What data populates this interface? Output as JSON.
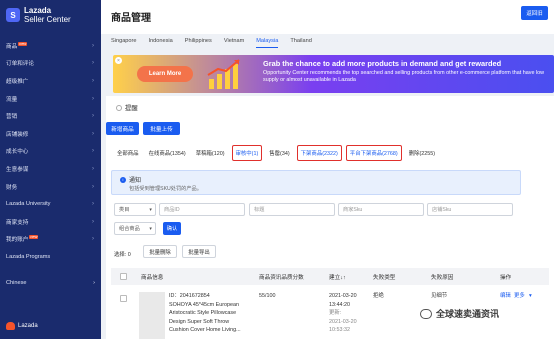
{
  "brand": {
    "name": "Lazada",
    "sub": "Seller Center",
    "logo_letter": "S"
  },
  "sidebar": {
    "items": [
      {
        "label": "商品",
        "badge": "new"
      },
      {
        "label": "订单和评论",
        "badge": ""
      },
      {
        "label": "超级推广",
        "badge": ""
      },
      {
        "label": "流量",
        "badge": ""
      },
      {
        "label": "营销",
        "badge": ""
      },
      {
        "label": "店铺装修",
        "badge": ""
      },
      {
        "label": "成长中心",
        "badge": ""
      },
      {
        "label": "生意参谋",
        "badge": ""
      },
      {
        "label": "财务",
        "badge": ""
      },
      {
        "label": "Lazada University",
        "badge": ""
      },
      {
        "label": "商家支持",
        "badge": ""
      },
      {
        "label": "我的账户",
        "badge": "new"
      },
      {
        "label": "Lazada Programs",
        "badge": ""
      }
    ],
    "language": "Chinese",
    "footer_logo": "Lazada"
  },
  "header": {
    "title": "商品管理",
    "return_label": "返回旧"
  },
  "country_tabs": [
    "Singapore",
    "Indonesia",
    "Philippines",
    "Vietnam",
    "Malaysia",
    "Thailand"
  ],
  "active_country": "Malaysia",
  "banner": {
    "button": "Learn More",
    "title": "Grab the chance to add more products in demand and get rewarded",
    "desc": "Opportunity Center recommends the top searched and selling products from other e-commerce platform that have low supply or almost unavailable in Lazada"
  },
  "section": {
    "title": "提醒",
    "add_product": "新增商品",
    "bulk_upload": "批量上传"
  },
  "status_tabs": [
    {
      "label": "全部商品",
      "highlight": false
    },
    {
      "label": "在线商品(1354)",
      "highlight": false
    },
    {
      "label": "草稿箱(120)",
      "highlight": false
    },
    {
      "label": "审核中(1)",
      "highlight": true
    },
    {
      "label": "售罄(34)",
      "highlight": false
    },
    {
      "label": "下架商品(2322)",
      "highlight": true
    },
    {
      "label": "平台下架商品(2768)",
      "highlight": true
    },
    {
      "label": "删除(2255)",
      "highlight": false
    }
  ],
  "notice": {
    "title": "通知",
    "body": "包括受到管理SKU处罚的产品。"
  },
  "filters": {
    "category": "类目",
    "product_id": "商品ID",
    "title": "标题",
    "seller_sku": "商家Sku",
    "shop_sku": "店铺Sku",
    "combo": "组合商品",
    "product_name": "商品名称",
    "confirm": "确认"
  },
  "bulk": {
    "selected": "选择: 0",
    "delete": "批量删除",
    "export": "批量导出"
  },
  "table": {
    "headers": [
      "商品信息",
      "商品资讯品质分数",
      "建立↓↑",
      "失败类型",
      "失败原因",
      "操作"
    ],
    "row": {
      "id": "ID：2041672854",
      "name_lines": [
        "SOHOYA 45*45cm European",
        "Aristocratic Style Pillowcase",
        "Design Super Soft Throw",
        "Cushion Cover Home Living..."
      ],
      "score": "55/100",
      "created": "2021-03-20",
      "created_time": "13:44:20",
      "updated_label": "更新:",
      "updated": "2021-03-20",
      "updated_time": "10:53:32",
      "fail_type": "拒绝",
      "fail_reason": "见细节",
      "action_edit": "编辑",
      "action_more": "更多"
    }
  },
  "watermark": "全球速卖通资讯"
}
